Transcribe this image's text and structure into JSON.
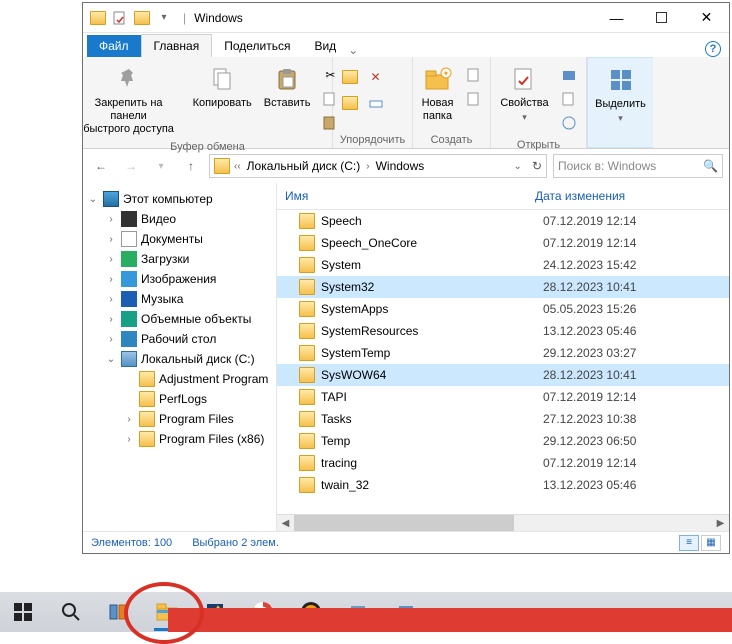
{
  "title": "Windows",
  "tabs": {
    "file": "Файл",
    "home": "Главная",
    "share": "Поделиться",
    "view": "Вид"
  },
  "ribbon": {
    "pin": "Закрепить на панели\nбыстрого доступа",
    "copy": "Копировать",
    "paste": "Вставить",
    "clipboard": "Буфер обмена",
    "organize": "Упорядочить",
    "newfolder": "Новая\nпапка",
    "create": "Создать",
    "properties": "Свойства",
    "open": "Открыть",
    "select": "Выделить"
  },
  "breadcrumb": {
    "a": "Локальный диск (C:)",
    "b": "Windows"
  },
  "search_placeholder": "Поиск в: Windows",
  "tree": {
    "this_pc": "Этот компьютер",
    "videos": "Видео",
    "documents": "Документы",
    "downloads": "Загрузки",
    "pictures": "Изображения",
    "music": "Музыка",
    "objects3d": "Объемные объекты",
    "desktop": "Рабочий стол",
    "localdisk": "Локальный диск (C:)",
    "adj": "Adjustment Program",
    "perflogs": "PerfLogs",
    "progfiles": "Program Files",
    "progfiles86": "Program Files (x86)"
  },
  "columns": {
    "name": "Имя",
    "date": "Дата изменения"
  },
  "files": [
    {
      "name": "Speech",
      "date": "07.12.2019 12:14",
      "sel": false
    },
    {
      "name": "Speech_OneCore",
      "date": "07.12.2019 12:14",
      "sel": false
    },
    {
      "name": "System",
      "date": "24.12.2023 15:42",
      "sel": false
    },
    {
      "name": "System32",
      "date": "28.12.2023 10:41",
      "sel": true
    },
    {
      "name": "SystemApps",
      "date": "05.05.2023 15:26",
      "sel": false
    },
    {
      "name": "SystemResources",
      "date": "13.12.2023 05:46",
      "sel": false
    },
    {
      "name": "SystemTemp",
      "date": "29.12.2023 03:27",
      "sel": false
    },
    {
      "name": "SysWOW64",
      "date": "28.12.2023 10:41",
      "sel": true
    },
    {
      "name": "TAPI",
      "date": "07.12.2019 12:14",
      "sel": false
    },
    {
      "name": "Tasks",
      "date": "27.12.2023 10:38",
      "sel": false
    },
    {
      "name": "Temp",
      "date": "29.12.2023 06:50",
      "sel": false
    },
    {
      "name": "tracing",
      "date": "07.12.2019 12:14",
      "sel": false
    },
    {
      "name": "twain_32",
      "date": "13.12.2023 05:46",
      "sel": false
    }
  ],
  "status": {
    "items": "Элементов: 100",
    "selected": "Выбрано 2 элем."
  }
}
